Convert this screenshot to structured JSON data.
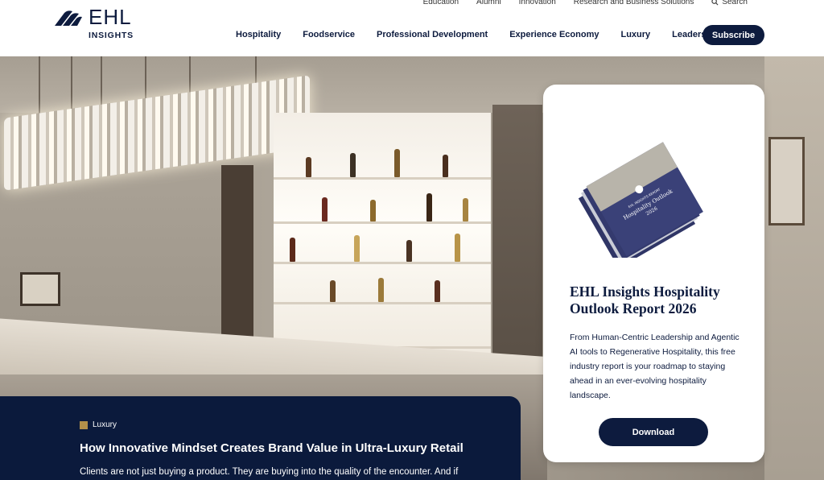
{
  "brand": {
    "name": "EHL",
    "subtitle": "INSIGHTS"
  },
  "top_links": [
    "Education",
    "Alumni",
    "Innovation",
    "Research and Business Solutions"
  ],
  "search": {
    "label": "Search",
    "icon": "search-icon"
  },
  "main_nav": [
    "Hospitality",
    "Foodservice",
    "Professional Development",
    "Experience Economy",
    "Luxury",
    "Leaders"
  ],
  "subscribe_label": "Subscribe",
  "article": {
    "tag": "Luxury",
    "title": "How Innovative Mindset Creates Brand Value in Ultra-Luxury Retail",
    "excerpt": "Clients are not just buying a product. They are buying into the quality of the encounter. And if"
  },
  "report": {
    "cover_header": "EHL INSIGHTS REPORT",
    "cover_title": "Hospitality Outlook",
    "cover_year": "2026",
    "title": "EHL Insights Hospitality Outlook Report 2026",
    "description": "From Human-Centric Leadership and Agentic AI tools to Regenerative Hospitality, this free industry report is your roadmap to staying ahead in an ever-evolving hospitality landscape.",
    "download_label": "Download"
  },
  "colors": {
    "navy": "#0d1b3e",
    "gold_tag": "#b2904a",
    "white": "#ffffff"
  }
}
